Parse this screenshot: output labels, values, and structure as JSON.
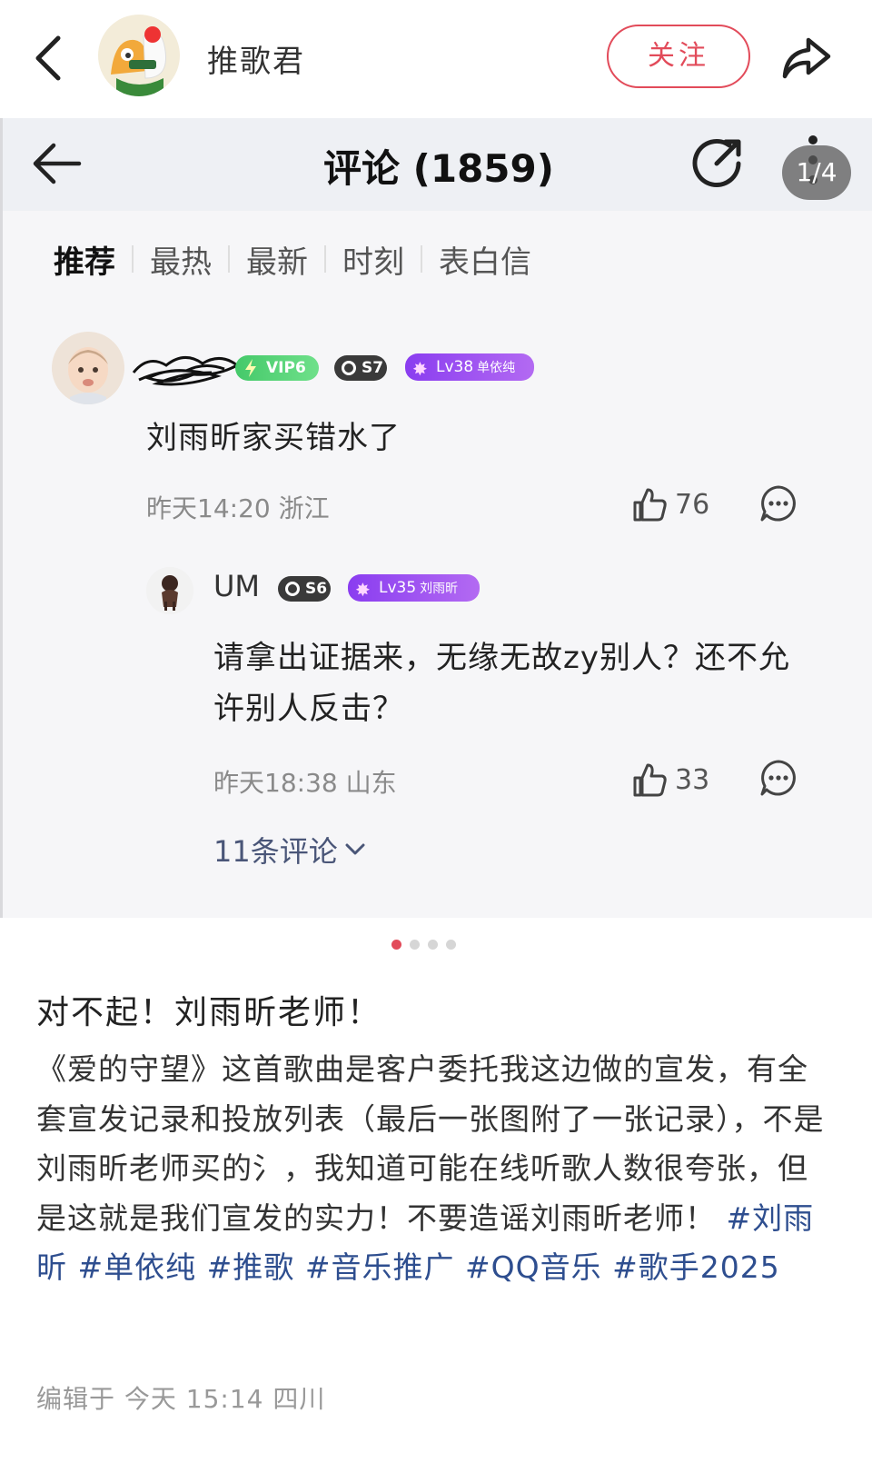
{
  "topbar": {
    "username": "推歌君",
    "follow_label": "关注"
  },
  "comments_screen": {
    "title": "评论 (1859)",
    "page_indicator": "1/4",
    "tabs": [
      "推荐",
      "最热",
      "最新",
      "时刻",
      "表白信"
    ],
    "comment": {
      "badges": {
        "vip": "VIP6",
        "s": "S7",
        "lv": "Lv38",
        "lv_name": "单依纯"
      },
      "text": "刘雨昕家买错水了",
      "meta": "昨天14:20 浙江",
      "likes": "76"
    },
    "reply": {
      "username": "UM",
      "badges": {
        "s": "S6",
        "lv": "Lv35",
        "lv_name": "刘雨昕"
      },
      "text": "请拿出证据来，无缘无故zy别人？还不允许别人反击？",
      "meta": "昨天18:38 山东",
      "likes": "33"
    },
    "more_replies": "11条评论"
  },
  "carousel": {
    "count": 4,
    "active": 0
  },
  "post": {
    "title": "对不起！刘雨昕老师！",
    "body": "《爱的守望》这首歌曲是客户委托我这边做的宣发，有全套宣发记录和投放列表（最后一张图附了一张记录），不是刘雨昕老师买的氵，我知道可能在线听歌人数很夸张，但是这就是我们宣发的实力！不要造谣刘雨昕老师！",
    "tags": [
      "#刘雨昕",
      "#单依纯",
      "#推歌",
      "#音乐推广",
      "#QQ音乐",
      "#歌手2025"
    ],
    "meta": "编辑于 今天 15:14 四川"
  },
  "colors": {
    "accent": "#e24b5a",
    "tag": "#2e4e8f",
    "lv_badge": "#8a3df0",
    "vip_badge": "#45c96a"
  },
  "icons": [
    "back-icon",
    "share-icon",
    "arrow-left-icon",
    "share-external-icon",
    "more-vertical-icon",
    "thumbs-up-icon",
    "comment-bubble-icon",
    "chevron-down-icon"
  ]
}
